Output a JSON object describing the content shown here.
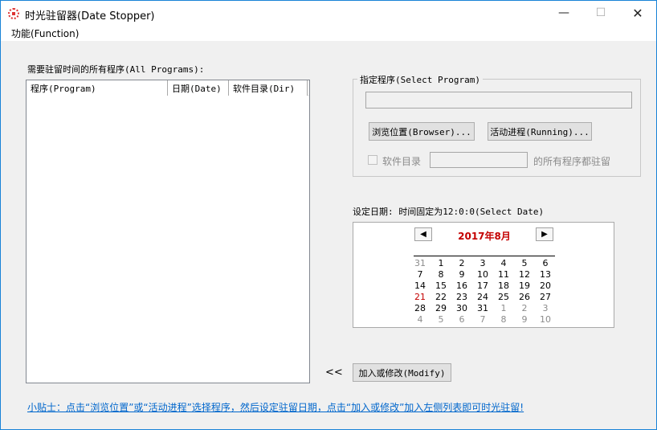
{
  "window": {
    "title": "时光驻留器(Date Stopper)",
    "minimize": "—",
    "maximize": "☐",
    "close": "✕"
  },
  "menu": {
    "function": "功能(Function)"
  },
  "left": {
    "label": "需要驻留时间的所有程序(All Programs):",
    "columns": [
      "程序(Program)",
      "日期(Date)",
      "软件目录(Dir)"
    ]
  },
  "select_group": {
    "title": "指定程序(Select Program)",
    "path_value": "",
    "browse_button": "浏览位置(Browser)...",
    "running_button": "活动进程(Running)...",
    "dir_checkbox_label": "软件目录",
    "dir_value": "",
    "dir_suffix": "的所有程序都驻留"
  },
  "date_section": {
    "label": "设定日期: 时间固定为12:0:0(Select Date)",
    "calendar": {
      "title": "2017年8月",
      "prev": "◀",
      "next": "▶",
      "weeks": [
        [
          {
            "d": "31",
            "t": "other"
          },
          {
            "d": "1"
          },
          {
            "d": "2"
          },
          {
            "d": "3"
          },
          {
            "d": "4"
          },
          {
            "d": "5"
          },
          {
            "d": "6"
          }
        ],
        [
          {
            "d": "7"
          },
          {
            "d": "8"
          },
          {
            "d": "9"
          },
          {
            "d": "10"
          },
          {
            "d": "11"
          },
          {
            "d": "12"
          },
          {
            "d": "13"
          }
        ],
        [
          {
            "d": "14"
          },
          {
            "d": "15"
          },
          {
            "d": "16"
          },
          {
            "d": "17"
          },
          {
            "d": "18"
          },
          {
            "d": "19"
          },
          {
            "d": "20"
          }
        ],
        [
          {
            "d": "21",
            "t": "today"
          },
          {
            "d": "22"
          },
          {
            "d": "23"
          },
          {
            "d": "24"
          },
          {
            "d": "25"
          },
          {
            "d": "26"
          },
          {
            "d": "27"
          }
        ],
        [
          {
            "d": "28"
          },
          {
            "d": "29"
          },
          {
            "d": "30"
          },
          {
            "d": "31"
          },
          {
            "d": "1",
            "t": "other"
          },
          {
            "d": "2",
            "t": "other"
          },
          {
            "d": "3",
            "t": "other"
          }
        ],
        [
          {
            "d": "4",
            "t": "other"
          },
          {
            "d": "5",
            "t": "other"
          },
          {
            "d": "6",
            "t": "other"
          },
          {
            "d": "7",
            "t": "other"
          },
          {
            "d": "8",
            "t": "other"
          },
          {
            "d": "9",
            "t": "other"
          },
          {
            "d": "10",
            "t": "other"
          }
        ]
      ]
    }
  },
  "actions": {
    "move_left": "<<",
    "modify_button": "加入或修改(Modify)"
  },
  "tip": "小贴士：点击“浏览位置”或“活动进程”选择程序，然后设定驻留日期，点击“加入或修改”加入左侧列表即可时光驻留!",
  "colors": {
    "accent": "#1883d7",
    "today": "#c40000",
    "link": "#0066cc"
  }
}
